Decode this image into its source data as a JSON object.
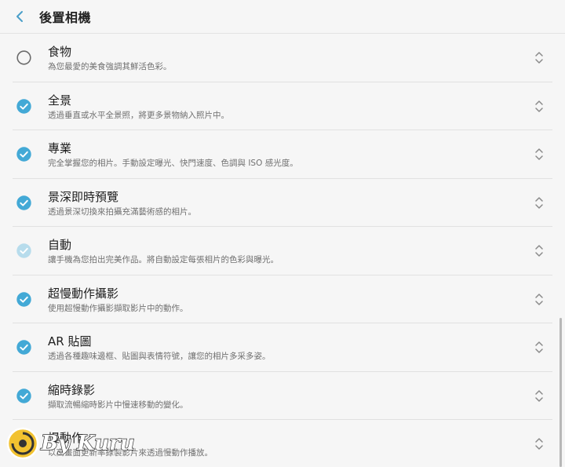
{
  "header": {
    "title": "後置相機"
  },
  "colors": {
    "accent": "#43a9d6",
    "accent_faded": "#b7dcec"
  },
  "modes": [
    {
      "title": "食物",
      "desc": "為您最愛的美食強調其鮮活色彩。",
      "state": "unchecked"
    },
    {
      "title": "全景",
      "desc": "透過垂直或水平全景照，將更多景物納入照片中。",
      "state": "checked"
    },
    {
      "title": "專業",
      "desc": "完全掌握您的相片。手動設定曝光、快門速度、色調與 ISO 感光度。",
      "state": "checked"
    },
    {
      "title": "景深即時預覽",
      "desc": "透過景深切換來拍攝充滿藝術感的相片。",
      "state": "checked"
    },
    {
      "title": "自動",
      "desc": "讓手機為您拍出完美作品。將自動設定每張相片的色彩與曝光。",
      "state": "checked-disabled"
    },
    {
      "title": "超慢動作攝影",
      "desc": "使用超慢動作攝影擷取影片中的動作。",
      "state": "checked"
    },
    {
      "title": "AR 貼圖",
      "desc": "透過各種趣味邊框、貼圖與表情符號，讓您的相片多采多姿。",
      "state": "checked"
    },
    {
      "title": "縮時錄影",
      "desc": "擷取流暢縮時影片中慢速移動的變化。",
      "state": "checked"
    },
    {
      "title": "慢動作",
      "desc": "以高畫面更新率錄製影片來透過慢動作播放。",
      "state": "unchecked"
    }
  ],
  "watermark": {
    "text": "By Kuru"
  }
}
